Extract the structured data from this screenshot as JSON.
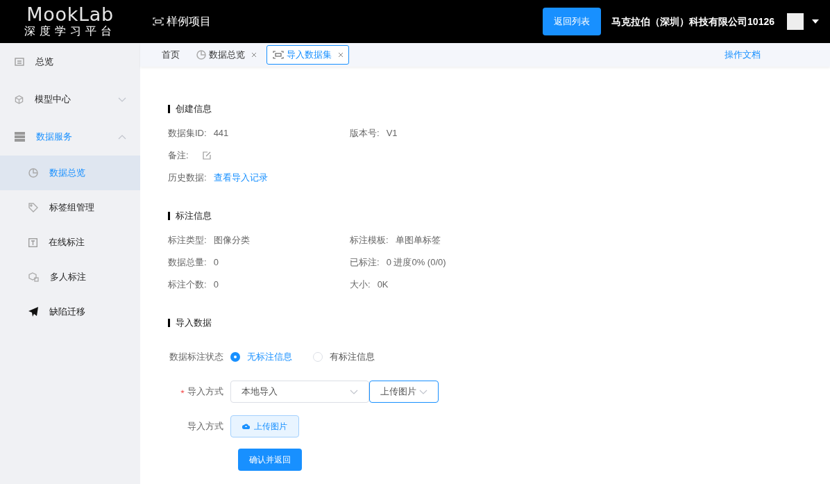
{
  "header": {
    "logo_title": "MookLab",
    "logo_subtitle": "深度学习平台",
    "project": "样例项目",
    "back_button": "返回列表",
    "company": "马克拉伯（深圳）科技有限公司10126"
  },
  "sidebar": {
    "items": [
      {
        "label": "总览",
        "selected": false
      },
      {
        "label": "模型中心",
        "expanded": false,
        "selected": false
      },
      {
        "label": "数据服务",
        "expanded": true,
        "selected": true,
        "children": [
          {
            "label": "数据总览",
            "selected": true
          },
          {
            "label": "标签组管理",
            "selected": false
          },
          {
            "label": "在线标注",
            "selected": false
          },
          {
            "label": "多人标注",
            "selected": false
          },
          {
            "label": "缺陷迁移",
            "selected": false
          }
        ]
      }
    ]
  },
  "tabs": [
    {
      "label": "首页",
      "closable": false,
      "selected": false
    },
    {
      "label": "数据总览",
      "closable": true,
      "selected": false
    },
    {
      "label": "导入数据集",
      "closable": true,
      "selected": true
    }
  ],
  "help_link": "操作文档",
  "sections": [
    {
      "title": "创建信息",
      "rows": [
        [
          {
            "kind": "text",
            "label": "数据集ID:",
            "value": "441"
          },
          {
            "kind": "text",
            "label": "版本号:",
            "value": "V1"
          }
        ],
        [
          {
            "kind": "edit",
            "label": "备注:"
          }
        ],
        [
          {
            "kind": "link",
            "label": "历史数据:",
            "value": "查看导入记录"
          }
        ]
      ]
    },
    {
      "title": "标注信息",
      "rows": [
        [
          {
            "kind": "text",
            "label": "标注类型:",
            "value": "图像分类"
          },
          {
            "kind": "text",
            "label": "标注模板:",
            "value": "单图单标签"
          }
        ],
        [
          {
            "kind": "text",
            "label": "数据总量:",
            "value": "0"
          },
          {
            "kind": "text",
            "label": "已标注:",
            "value": "0 进度0% (0/0)"
          }
        ],
        [
          {
            "kind": "text",
            "label": "标注个数:",
            "value": "0"
          },
          {
            "kind": "text",
            "label": "大小:",
            "value": "0K"
          }
        ]
      ]
    },
    {
      "title": "导入数据"
    }
  ],
  "form": {
    "status": {
      "label": "数据标注状态",
      "options": [
        {
          "label": "无标注信息",
          "selected": true
        },
        {
          "label": "有标注信息",
          "selected": false
        }
      ]
    },
    "method": {
      "label": "导入方式",
      "required": true,
      "select": "本地导入",
      "select_2": "上传图片"
    },
    "upload": {
      "label": "导入方式",
      "button": "上传图片"
    },
    "submit": "确认并返回"
  }
}
